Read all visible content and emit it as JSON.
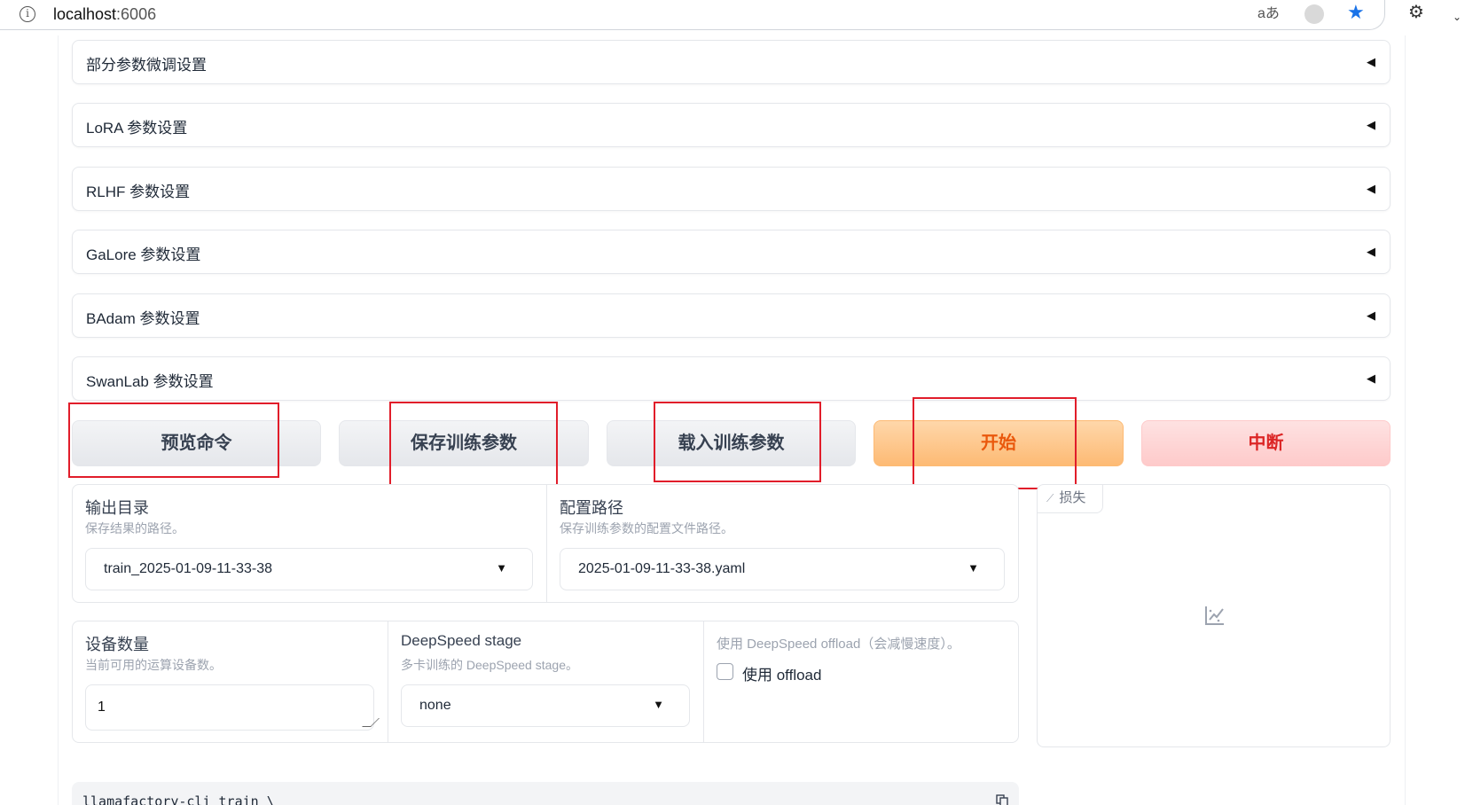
{
  "browser": {
    "url_host": "localhost",
    "url_port": ":6006",
    "info_glyph": "i",
    "translate_glyph": "aあ",
    "star_glyph": "★",
    "ext_glyph": "⚙",
    "chevron_glyph": "⌄"
  },
  "accordions": [
    {
      "label": "部分参数微调设置",
      "arrow": "◀"
    },
    {
      "label": "LoRA 参数设置",
      "arrow": "◀"
    },
    {
      "label": "RLHF 参数设置",
      "arrow": "◀"
    },
    {
      "label": "GaLore 参数设置",
      "arrow": "◀"
    },
    {
      "label": "BAdam 参数设置",
      "arrow": "◀"
    },
    {
      "label": "SwanLab 参数设置",
      "arrow": "◀"
    }
  ],
  "actions": {
    "preview": "预览命令",
    "save": "保存训练参数",
    "load": "载入训练参数",
    "start": "开始",
    "stop": "中断"
  },
  "output": {
    "output_dir": {
      "label": "输出目录",
      "info": "保存结果的路径。",
      "value": "train_2025-01-09-11-33-38"
    },
    "config_path": {
      "label": "配置路径",
      "info": "保存训练参数的配置文件路径。",
      "value": "2025-01-09-11-33-38.yaml"
    }
  },
  "device": {
    "device_count": {
      "label": "设备数量",
      "info": "当前可用的运算设备数。",
      "value": "1"
    },
    "ds_stage": {
      "label": "DeepSpeed stage",
      "info": "多卡训练的 DeepSpeed stage。",
      "value": "none"
    },
    "ds_offload": {
      "label": "使用 DeepSpeed offload（会减慢速度）。",
      "checkbox_label": "使用 offload",
      "checked": false
    }
  },
  "plot": {
    "tag_label": "损失"
  },
  "command": {
    "text": "llamafactory-cli train \\"
  },
  "colors": {
    "start": "#ea580c",
    "stop": "#dc2626",
    "annotation": "#e11d2a"
  }
}
